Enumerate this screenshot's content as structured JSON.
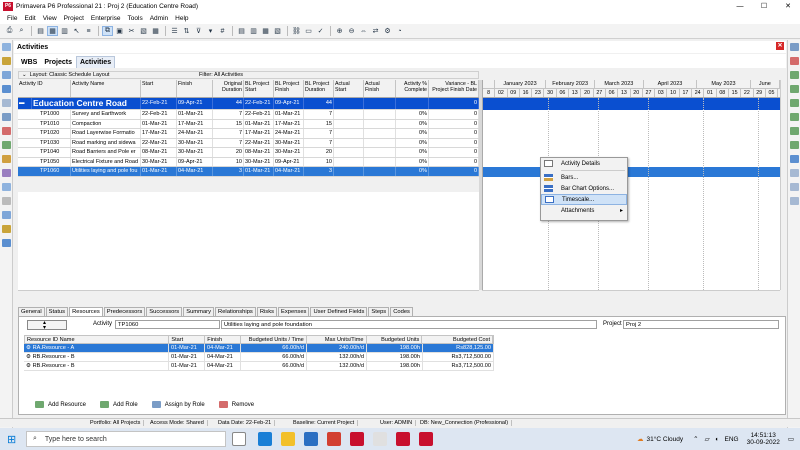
{
  "window": {
    "title": "Primavera P6 Professional 21 : Proj 2 (Education Centre Road)",
    "logo": "P6",
    "min": "—",
    "max": "☐",
    "close": "✕"
  },
  "menu": [
    "File",
    "Edit",
    "View",
    "Project",
    "Enterprise",
    "Tools",
    "Admin",
    "Help"
  ],
  "pane": {
    "title": "Activities"
  },
  "tabs": [
    "WBS",
    "Projects",
    "Activities"
  ],
  "layout_bar": {
    "layout": "Layout: Classic Schedule Layout",
    "filter": "Filter: All Activities"
  },
  "grid": {
    "headers": [
      "Activity ID",
      "Activity Name",
      "Start",
      "Finish",
      "Original Duration",
      "BL Project Start",
      "BL Project Finish",
      "BL Project Duration",
      "Actual Start",
      "Actual Finish",
      "Activity % Complete",
      "Variance - BL Project Finish Date"
    ],
    "wbs": {
      "name": "Education Centre Road",
      "start": "22-Feb-21",
      "finish": "09-Apr-21",
      "od": "44",
      "bls": "22-Feb-21",
      "blf": "09-Apr-21",
      "bld": "44",
      "var": "0"
    },
    "rows": [
      {
        "id": "TP1000",
        "name": "Survey and Earthwork",
        "start": "22-Feb-21",
        "finish": "01-Mar-21",
        "od": "7",
        "bls": "22-Feb-21",
        "blf": "01-Mar-21",
        "bld": "7",
        "pct": "0%",
        "var": "0"
      },
      {
        "id": "TP1010",
        "name": "Compaction",
        "start": "01-Mar-21",
        "finish": "17-Mar-21",
        "od": "15",
        "bls": "01-Mar-21",
        "blf": "17-Mar-21",
        "bld": "15",
        "pct": "0%",
        "var": "0"
      },
      {
        "id": "TP1020",
        "name": "Road Layerwise Formatio",
        "start": "17-Mar-21",
        "finish": "24-Mar-21",
        "od": "7",
        "bls": "17-Mar-21",
        "blf": "24-Mar-21",
        "bld": "7",
        "pct": "0%",
        "var": "0"
      },
      {
        "id": "TP1030",
        "name": "Road marking and sidewa",
        "start": "22-Mar-21",
        "finish": "30-Mar-21",
        "od": "7",
        "bls": "22-Mar-21",
        "blf": "30-Mar-21",
        "bld": "7",
        "pct": "0%",
        "var": "0"
      },
      {
        "id": "TP1040",
        "name": "Road Barriers and Pole er",
        "start": "08-Mar-21",
        "finish": "30-Mar-21",
        "od": "20",
        "bls": "08-Mar-21",
        "blf": "30-Mar-21",
        "bld": "20",
        "pct": "0%",
        "var": "0"
      },
      {
        "id": "TP1050",
        "name": "Electrical Fixture and Road",
        "start": "30-Mar-21",
        "finish": "09-Apr-21",
        "od": "10",
        "bls": "30-Mar-21",
        "blf": "09-Apr-21",
        "bld": "10",
        "pct": "0%",
        "var": "0"
      },
      {
        "id": "TP1060",
        "name": "Utilities laying and pole fou",
        "start": "01-Mar-21",
        "finish": "04-Mar-21",
        "od": "3",
        "bls": "01-Mar-21",
        "blf": "04-Mar-21",
        "bld": "3",
        "pct": "0%",
        "var": "0"
      }
    ]
  },
  "gantt": {
    "months": [
      "January 2023",
      "February 2023",
      "March 2023",
      "April 2023",
      "May 2023",
      "June"
    ],
    "days": [
      "8",
      "02",
      "09",
      "16",
      "23",
      "30",
      "06",
      "13",
      "20",
      "27",
      "06",
      "13",
      "20",
      "27",
      "03",
      "10",
      "17",
      "24",
      "01",
      "08",
      "15",
      "22",
      "29",
      "05",
      "12"
    ]
  },
  "context_menu": [
    "Activity Details",
    "Bars...",
    "Bar Chart Options...",
    "Timescale...",
    "Attachments"
  ],
  "bottom_tabs": [
    "General",
    "Status",
    "Resources",
    "Predecessors",
    "Successors",
    "Summary",
    "Relationships",
    "Risks",
    "Expenses",
    "User Defined Fields",
    "Steps",
    "Codes"
  ],
  "detail": {
    "activity_label": "Activity",
    "activity_id": "TP1060",
    "activity_name": "Utilities laying and pole foundation",
    "project_label": "Project",
    "project": "Proj 2",
    "res_headers": [
      "Resource ID Name",
      "Start",
      "Finish",
      "Budgeted Units / Time",
      "Max Units/Time",
      "Budgeted Units",
      "Budgeted Cost"
    ],
    "res_rows": [
      [
        "RA.Resource - A",
        "01-Mar-21",
        "04-Mar-21",
        "66.00h/d",
        "240.00h/d",
        "198.00h",
        "Rs828,125.00"
      ],
      [
        "RB.Resource - B",
        "01-Mar-21",
        "04-Mar-21",
        "66.00h/d",
        "132.00h/d",
        "198.00h",
        "Rs3,712,500.00"
      ],
      [
        "RB.Resource - B",
        "01-Mar-21",
        "04-Mar-21",
        "66.00h/d",
        "132.00h/d",
        "198.00h",
        "Rs3,712,500.00"
      ]
    ],
    "buttons": [
      "Add Resource",
      "Add Role",
      "Assign by Role",
      "Remove"
    ]
  },
  "status": [
    "Portfolio: All Projects",
    "Access Mode: Shared",
    "Data Date: 22-Feb-21",
    "Baseline: Current Project",
    "User: ADMIN",
    "DB: New_Connection (Professional)"
  ],
  "taskbar": {
    "search": "Type here to search",
    "weather": "31°C  Cloudy",
    "lang": "ENG",
    "time": "14:51:13",
    "date": "30-09-2022"
  },
  "colors": {
    "wbs_band": "#0a4fd0",
    "selected": "#2a78d6"
  }
}
